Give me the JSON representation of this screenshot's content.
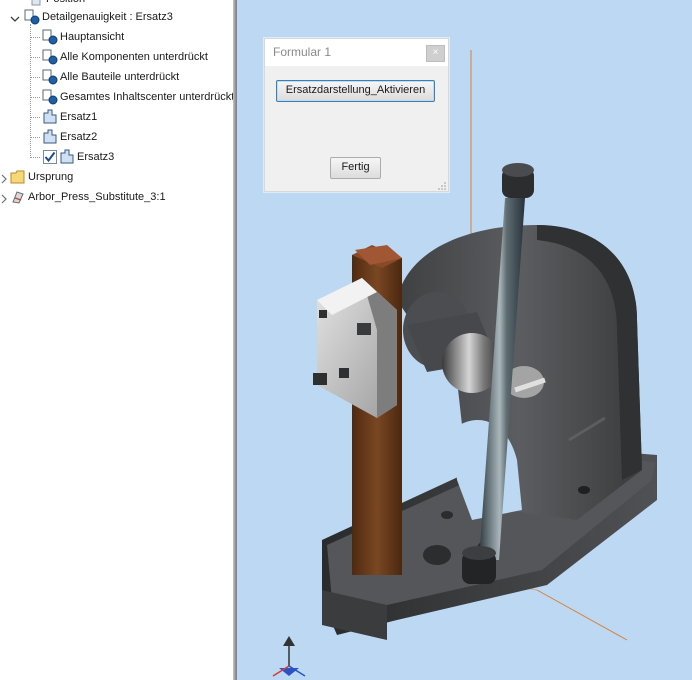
{
  "browser_tree": {
    "top_partial": "Position",
    "detail_level": "Detailgenauigkeit : Ersatz3",
    "children": [
      {
        "label": "Hauptansicht"
      },
      {
        "label": "Alle Komponenten unterdrückt"
      },
      {
        "label": "Alle Bauteile unterdrückt"
      },
      {
        "label": "Gesamtes Inhaltscenter unterdrückt"
      },
      {
        "label": "Ersatz1"
      },
      {
        "label": "Ersatz2"
      },
      {
        "label": "Ersatz3",
        "active": true
      }
    ],
    "origin": "Ursprung",
    "component": "Arbor_Press_Substitute_3:1"
  },
  "dialog": {
    "title": "Formular 1",
    "close_label": "×",
    "activate_button": "Ersatzdarstellung_Aktivieren",
    "done_button": "Fertig"
  },
  "colors": {
    "viewport_background": "#bdd8f2",
    "model_body": "#58595b",
    "ram": "#6b3d1f",
    "axis_line": "#d4823c"
  }
}
